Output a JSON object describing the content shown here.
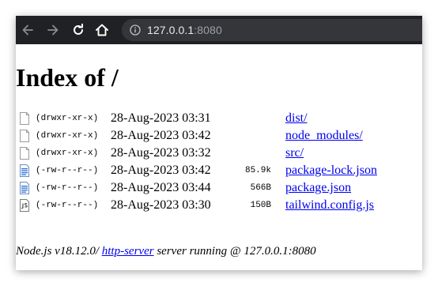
{
  "browser": {
    "url_host": "127.0.0.1",
    "url_port": ":8080",
    "back_icon": "arrow-left-icon",
    "forward_icon": "arrow-right-icon",
    "reload_icon": "reload-icon",
    "home_icon": "home-icon",
    "info_icon": "info-icon"
  },
  "page": {
    "title": "Index of /",
    "entries": [
      {
        "icon": "folder",
        "perm": "(drwxr-xr-x)",
        "date": "28-Aug-2023 03:31",
        "size": "",
        "name": "dist/"
      },
      {
        "icon": "folder",
        "perm": "(drwxr-xr-x)",
        "date": "28-Aug-2023 03:42",
        "size": "",
        "name": "node_modules/"
      },
      {
        "icon": "folder",
        "perm": "(drwxr-xr-x)",
        "date": "28-Aug-2023 03:32",
        "size": "",
        "name": "src/"
      },
      {
        "icon": "text-file",
        "perm": "(-rw-r--r--)",
        "date": "28-Aug-2023 03:42",
        "size": "85.9k",
        "name": "package-lock.json"
      },
      {
        "icon": "text-file",
        "perm": "(-rw-r--r--)",
        "date": "28-Aug-2023 03:44",
        "size": "566B",
        "name": "package.json"
      },
      {
        "icon": "js-file",
        "perm": "(-rw-r--r--)",
        "date": "28-Aug-2023 03:30",
        "size": "150B",
        "name": "tailwind.config.js"
      }
    ],
    "footer": {
      "prefix": "Node.js v18.12.0/ ",
      "link": "http-server",
      "suffix": " server running @ 127.0.0.1:8080"
    }
  },
  "colors": {
    "toolbar_bg": "#202124",
    "omnibox_bg": "#35363a",
    "link": "#0000ee"
  }
}
